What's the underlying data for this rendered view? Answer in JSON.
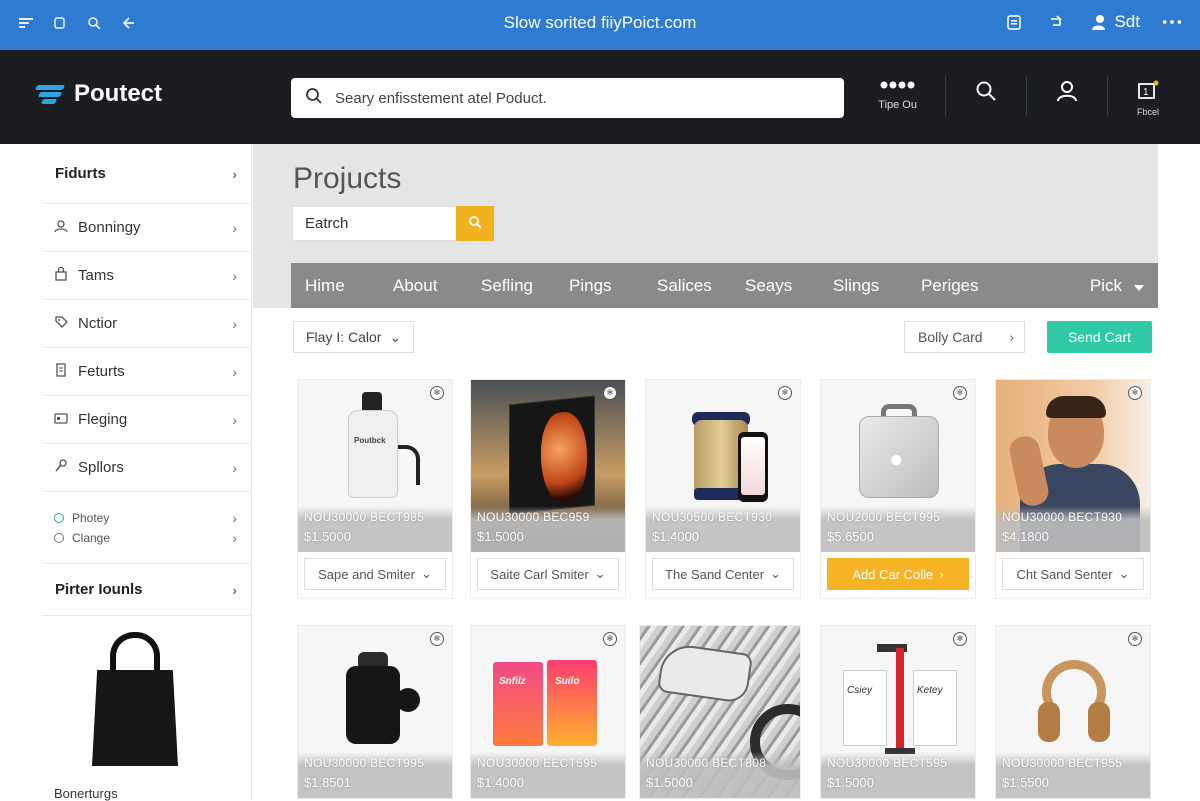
{
  "titlebar": {
    "title": "Slow sorited fiiyPoict.com",
    "right_label": "Sdt",
    "icons": [
      "menu-icon",
      "copy-icon",
      "search-icon",
      "back-arrow-icon",
      "clipboard-icon",
      "redo-icon",
      "user-icon",
      "more-icon"
    ]
  },
  "header": {
    "logo": "Poutect",
    "search_placeholder": "Seary enfisstement atel Poduct.",
    "more_label": "Tipe Ou",
    "cart_label": "Fbcel"
  },
  "sidebar": {
    "heading": "Fidurts",
    "items": [
      {
        "label": "Bonningy",
        "icon": "person-icon"
      },
      {
        "label": "Tams",
        "icon": "bag-icon"
      },
      {
        "label": "Nctior",
        "icon": "tag-icon"
      },
      {
        "label": "Feturts",
        "icon": "doc-icon"
      },
      {
        "label": "Fleging",
        "icon": "card-icon"
      },
      {
        "label": "Spllors",
        "icon": "tools-icon"
      }
    ],
    "small_items": [
      "Photey",
      "Clange"
    ],
    "section_title": "Pirter Iounls",
    "bottom_label": "Bonerturgs"
  },
  "main": {
    "page_title": "Projucts",
    "search_value": "Eatrch",
    "nav": [
      "Hime",
      "About",
      "Sefling",
      "Pings",
      "Salices",
      "Seays",
      "Slings",
      "Periges"
    ],
    "nav_pick": "Pick",
    "filter_label": "Flay I: Calor",
    "cart_view": "Bolly Card",
    "send_cart": "Send Cart"
  },
  "products_row1": [
    {
      "sku": "NOU30000 BECT985",
      "price": "$1.5000",
      "action": "Sape and Smiter",
      "primary": false
    },
    {
      "sku": "NOU30000 BEC959",
      "price": "$1.5000",
      "action": "Saite Carl Smiter",
      "primary": false
    },
    {
      "sku": "NOU30500 BECT930",
      "price": "$1.4000",
      "action": "The Sand Center",
      "primary": false
    },
    {
      "sku": "NOU2000 BECT995",
      "price": "$5.6500",
      "action": "Add Car Colle",
      "primary": true
    },
    {
      "sku": "NOU30000 BECT930",
      "price": "$4.1800",
      "action": "Cht Sand Senter",
      "primary": false
    }
  ],
  "products_row2": [
    {
      "sku": "NOU30000 BECT995",
      "price": "$1.8501"
    },
    {
      "sku": "NOU30000 EECT595",
      "price": "$1.4000"
    },
    {
      "sku": "NOU30000 BECT808",
      "price": "$1.5000"
    },
    {
      "sku": "NOU30000 BECT595",
      "price": "$1.5000"
    },
    {
      "sku": "NOU30000 BECT955",
      "price": "$1.5500"
    }
  ],
  "product_texts": {
    "bottle_label": "Poutbck",
    "snack_a": "Snfilz",
    "snack_b": "Suilo",
    "card_a": "Csiey",
    "card_b": "Ketey"
  },
  "colors": {
    "titlebar": "#2f7bd1",
    "header": "#1b1d21",
    "accent_yellow": "#f6b324",
    "accent_teal": "#2fc9a5",
    "nav_gray": "#8a8a8a"
  }
}
